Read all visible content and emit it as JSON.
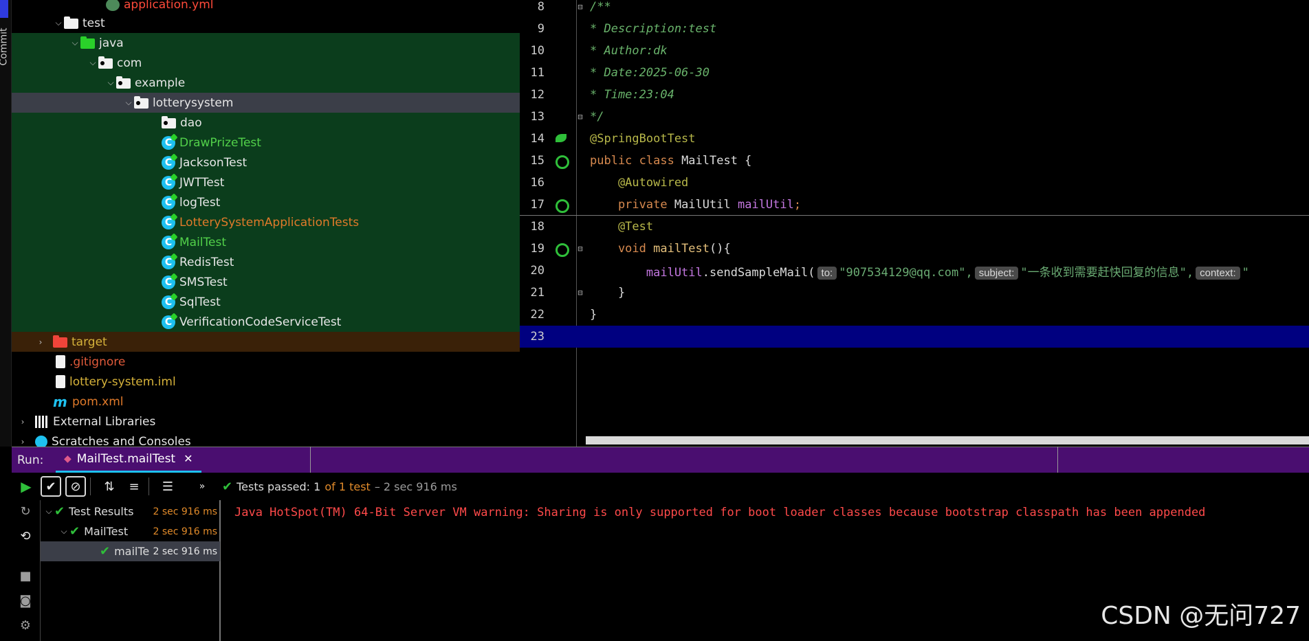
{
  "left_strip": {
    "label": "Commit"
  },
  "tree": {
    "items": [
      {
        "label": "application.yml"
      },
      {
        "label": "test"
      },
      {
        "label": "java"
      },
      {
        "label": "com"
      },
      {
        "label": "example"
      },
      {
        "label": "lotterysystem"
      },
      {
        "label": "dao"
      },
      {
        "label": "DrawPrizeTest"
      },
      {
        "label": "JacksonTest"
      },
      {
        "label": "JWTTest"
      },
      {
        "label": "logTest"
      },
      {
        "label": "LotterySystemApplicationTests"
      },
      {
        "label": "MailTest"
      },
      {
        "label": "RedisTest"
      },
      {
        "label": "SMSTest"
      },
      {
        "label": "SqlTest"
      },
      {
        "label": "VerificationCodeServiceTest"
      },
      {
        "label": "target"
      },
      {
        "label": ".gitignore"
      },
      {
        "label": "lottery-system.iml"
      },
      {
        "label": "pom.xml"
      },
      {
        "label": "External Libraries"
      },
      {
        "label": "Scratches and Consoles"
      }
    ]
  },
  "editor": {
    "lines": [
      {
        "num": "8",
        "text": "/**"
      },
      {
        "num": "9",
        "text": " * Description:test"
      },
      {
        "num": "10",
        "text": " * Author:dk"
      },
      {
        "num": "11",
        "text": " * Date:2025-06-30"
      },
      {
        "num": "12",
        "text": " * Time:23:04"
      },
      {
        "num": "13",
        "text": " */"
      },
      {
        "num": "14",
        "text": "@SpringBootTest"
      },
      {
        "num": "15",
        "kw": "public class",
        "name": " MailTest {"
      },
      {
        "num": "16",
        "text": "    @Autowired"
      },
      {
        "num": "17",
        "kw": "    private",
        "type": " MailUtil ",
        "field": "mailUtil",
        "semi": ";"
      },
      {
        "num": "18",
        "text": "    @Test"
      },
      {
        "num": "19",
        "kw": "    void",
        "method": " mailTest",
        "rest": "(){"
      },
      {
        "num": "20",
        "field": "        mailUtil",
        "call": ".sendSampleMail(",
        "hint1": "to:",
        "str1": "\"907534129@qq.com\",",
        "hint2": "subject:",
        "str2": "\"一条收到需要赶快回复的信息\",",
        "hint3": "context:",
        "str3": "\""
      },
      {
        "num": "21",
        "text": "    }"
      },
      {
        "num": "22",
        "text": "}"
      },
      {
        "num": "23",
        "text": ""
      }
    ]
  },
  "run": {
    "label": "Run:",
    "tab_label": "MailTest.mailTest",
    "status_passed": "Tests passed: 1",
    "status_of": "of 1 test",
    "status_duration": "– 2 sec 916 ms"
  },
  "test_tree": {
    "rows": [
      {
        "label": "Test Results",
        "time": "2 sec 916 ms"
      },
      {
        "label": "MailTest",
        "time": "2 sec 916 ms"
      },
      {
        "label": "mailTe",
        "time": "2 sec 916 ms"
      }
    ]
  },
  "console": {
    "line": "Java HotSpot(TM) 64-Bit Server VM warning: Sharing is only supported for boot loader classes because bootstrap classpath has been appended"
  },
  "watermark": "CSDN @无问727",
  "colors": {
    "accent": "#1ec1f0",
    "run_bar": "#4a0e70",
    "pass_green": "#2fbf3a",
    "error_red": "#ff4a4a"
  }
}
